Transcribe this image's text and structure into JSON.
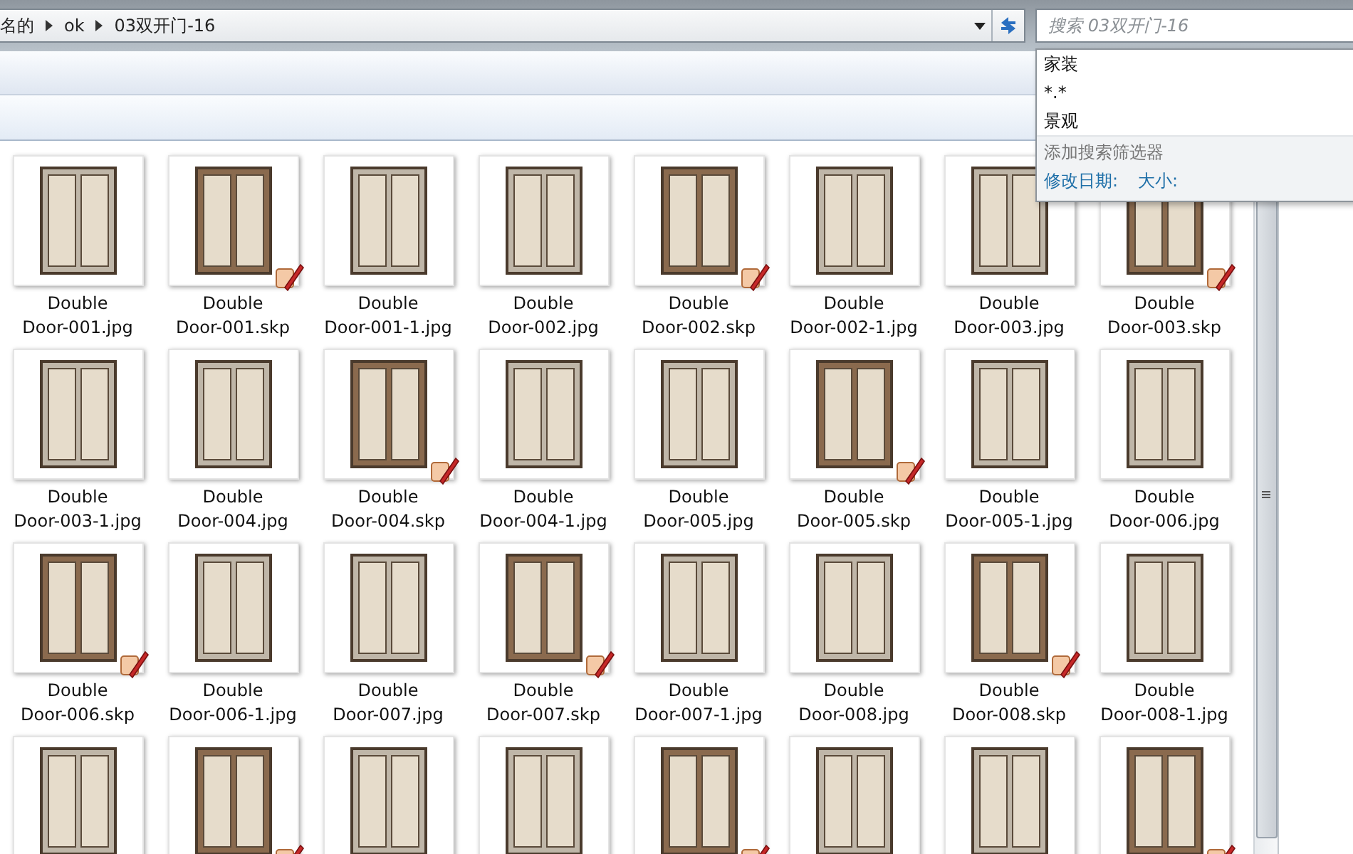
{
  "address_bar": {
    "crumbs": [
      "名的",
      "ok",
      "03双开门-16"
    ]
  },
  "search": {
    "placeholder": "搜索 03双开门-16"
  },
  "search_dropdown": {
    "recent": [
      "家装",
      "*.*",
      "景观"
    ],
    "filter_heading": "添加搜索筛选器",
    "filters": [
      "修改日期:",
      "大小:"
    ]
  },
  "files": [
    {
      "line1": "Double",
      "line2": "Door-001.jpg",
      "kind": "image"
    },
    {
      "line1": "Double",
      "line2": "Door-001.skp",
      "kind": "model"
    },
    {
      "line1": "Double",
      "line2": "Door-001-1.jpg",
      "kind": "image"
    },
    {
      "line1": "Double",
      "line2": "Door-002.jpg",
      "kind": "image"
    },
    {
      "line1": "Double",
      "line2": "Door-002.skp",
      "kind": "model"
    },
    {
      "line1": "Double",
      "line2": "Door-002-1.jpg",
      "kind": "image"
    },
    {
      "line1": "Double",
      "line2": "Door-003.jpg",
      "kind": "image"
    },
    {
      "line1": "Double",
      "line2": "Door-003.skp",
      "kind": "model"
    },
    {
      "line1": "Double",
      "line2": "Door-003-1.jpg",
      "kind": "image"
    },
    {
      "line1": "Double",
      "line2": "Door-004.jpg",
      "kind": "image"
    },
    {
      "line1": "Double",
      "line2": "Door-004.skp",
      "kind": "model"
    },
    {
      "line1": "Double",
      "line2": "Door-004-1.jpg",
      "kind": "image"
    },
    {
      "line1": "Double",
      "line2": "Door-005.jpg",
      "kind": "image"
    },
    {
      "line1": "Double",
      "line2": "Door-005.skp",
      "kind": "model"
    },
    {
      "line1": "Double",
      "line2": "Door-005-1.jpg",
      "kind": "image"
    },
    {
      "line1": "Double",
      "line2": "Door-006.jpg",
      "kind": "image"
    },
    {
      "line1": "Double",
      "line2": "Door-006.skp",
      "kind": "model"
    },
    {
      "line1": "Double",
      "line2": "Door-006-1.jpg",
      "kind": "image"
    },
    {
      "line1": "Double",
      "line2": "Door-007.jpg",
      "kind": "image"
    },
    {
      "line1": "Double",
      "line2": "Door-007.skp",
      "kind": "model"
    },
    {
      "line1": "Double",
      "line2": "Door-007-1.jpg",
      "kind": "image"
    },
    {
      "line1": "Double",
      "line2": "Door-008.jpg",
      "kind": "image"
    },
    {
      "line1": "Double",
      "line2": "Door-008.skp",
      "kind": "model"
    },
    {
      "line1": "Double",
      "line2": "Door-008-1.jpg",
      "kind": "image"
    },
    {
      "kind": "image"
    },
    {
      "kind": "model"
    },
    {
      "kind": "image"
    },
    {
      "kind": "image"
    },
    {
      "kind": "model"
    },
    {
      "kind": "image"
    },
    {
      "kind": "image"
    },
    {
      "kind": "model"
    }
  ]
}
